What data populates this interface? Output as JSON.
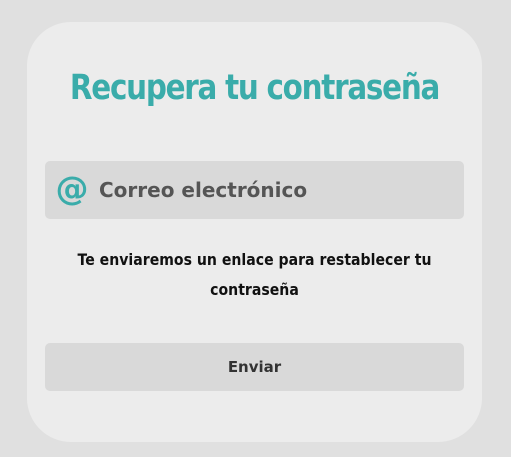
{
  "page": {
    "background_color": "#e0e0e0",
    "card_color": "#ececec"
  },
  "header": {
    "title": "Recupera tu contraseña",
    "title_color": "#3aacaa"
  },
  "form": {
    "email": {
      "icon": "at-icon",
      "icon_glyph": "@",
      "icon_color": "#3aacaa",
      "placeholder": "Correo electrónico",
      "value": ""
    },
    "info_text": "Te enviaremos un enlace para restablecer tu contraseña",
    "submit_label": "Enviar"
  }
}
